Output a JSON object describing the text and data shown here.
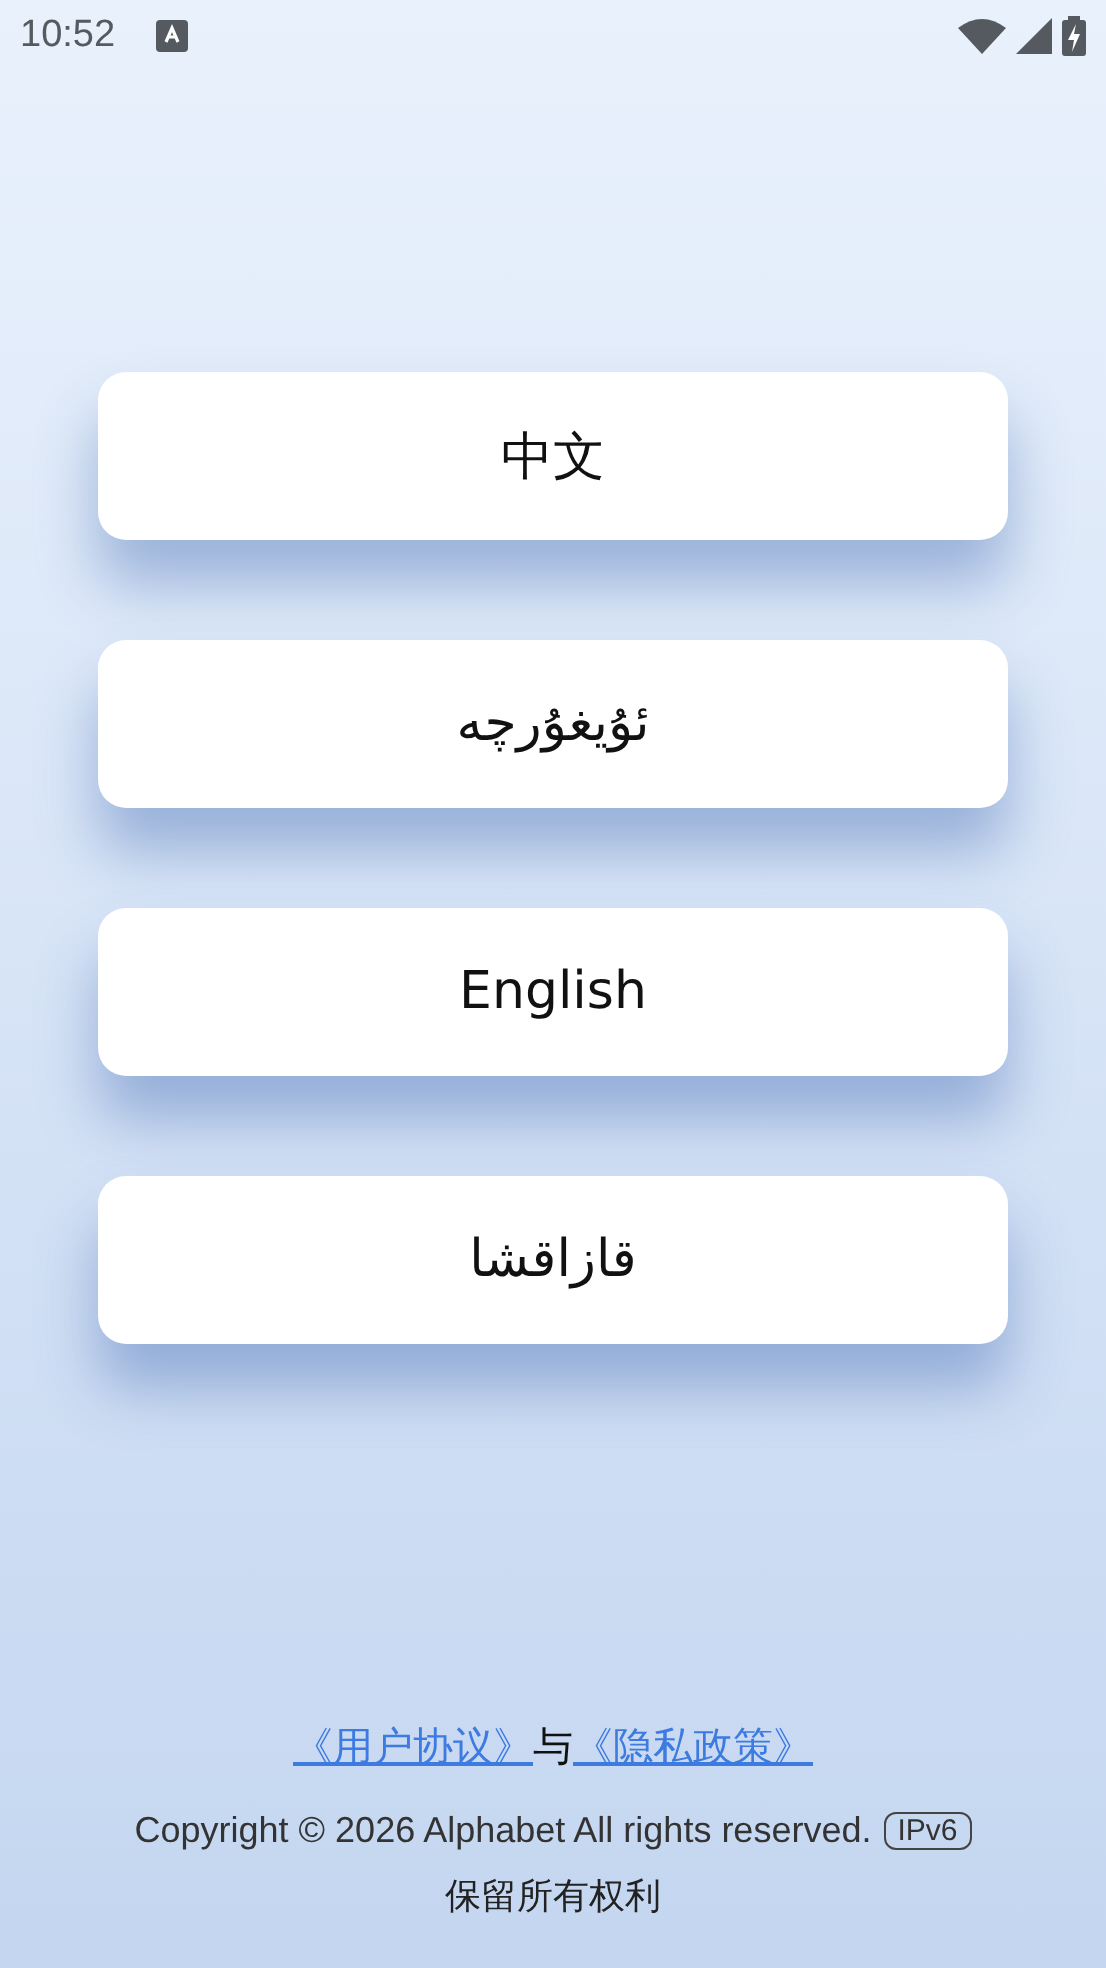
{
  "status_bar": {
    "time": "10:52"
  },
  "languages": [
    {
      "label": "中文"
    },
    {
      "label": "ئۇيغۇرچە"
    },
    {
      "label": "English"
    },
    {
      "label": "قازاقشا"
    }
  ],
  "footer": {
    "links": [
      {
        "kind": "link",
        "text": "《用户协议》"
      },
      {
        "kind": "text",
        "text": "与"
      },
      {
        "kind": "link",
        "text": "《隐私政策》"
      }
    ],
    "copyright": "Copyright © 2026 Alphabet All rights reserved.",
    "badge": "IPv6",
    "rights": "保留所有权利"
  }
}
